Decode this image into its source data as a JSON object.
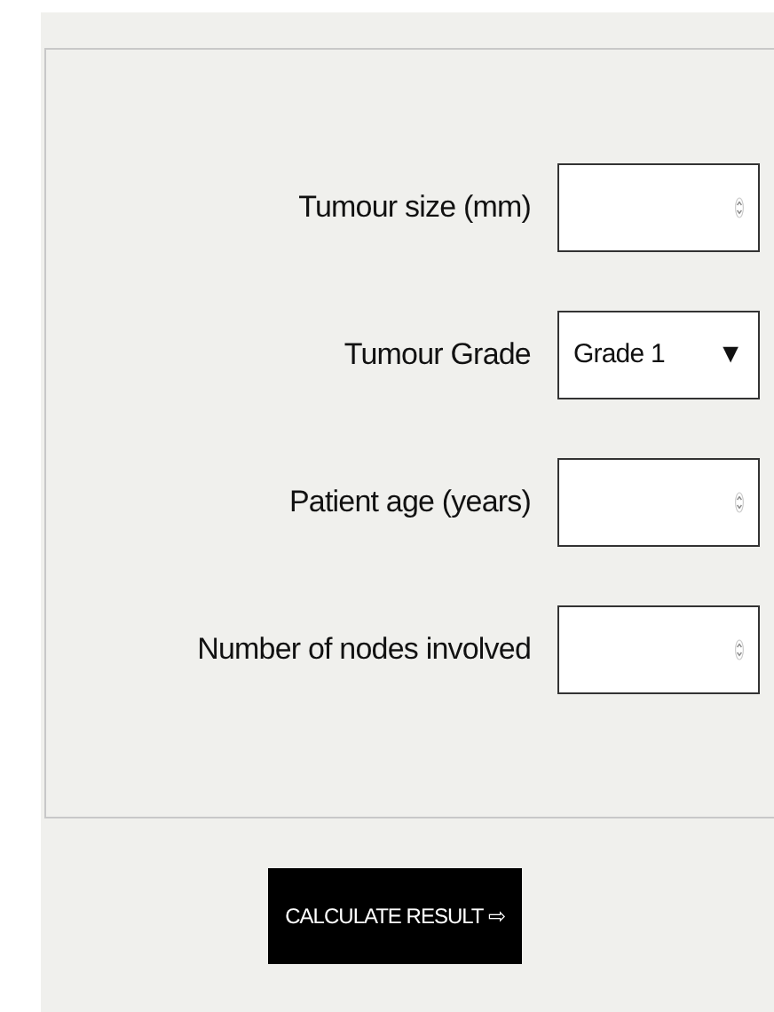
{
  "form": {
    "fields": [
      {
        "kind": "number",
        "label": "Tumour size (mm)"
      },
      {
        "kind": "select",
        "label": "Tumour Grade",
        "value": "Grade 1",
        "caret": "▼"
      },
      {
        "kind": "number",
        "label": "Patient age (years)"
      },
      {
        "kind": "number",
        "label": "Number of nodes involved"
      }
    ]
  },
  "button": {
    "label": "CALCULATE RESULT ⇨"
  }
}
